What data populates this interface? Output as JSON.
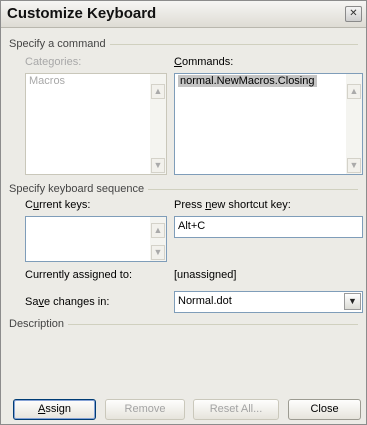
{
  "window": {
    "title": "Customize Keyboard",
    "close_glyph": "✕"
  },
  "command_group": {
    "label": "Specify a command",
    "categories_label": "Categories:",
    "categories_items": [
      "Macros"
    ],
    "commands_label": "Commands:",
    "commands_items": [
      "normal.NewMacros.Closing"
    ]
  },
  "keyboard_group": {
    "label": "Specify keyboard sequence",
    "current_keys_label": "Current keys:",
    "current_keys_items": [],
    "press_shortcut_label": "Press new shortcut key:",
    "shortcut_value": "Alt+C",
    "assigned_label": "Currently assigned to:",
    "assigned_value": "[unassigned]",
    "save_label": "Save changes in:",
    "save_value": "Normal.dot"
  },
  "description_group": {
    "label": "Description"
  },
  "buttons": {
    "assign": "Assign",
    "remove": "Remove",
    "reset_all": "Reset All...",
    "close": "Close"
  },
  "icons": {
    "scroll_up": "up-arrow-icon",
    "scroll_down": "down-arrow-icon",
    "combo_down": "chevron-down-icon"
  }
}
